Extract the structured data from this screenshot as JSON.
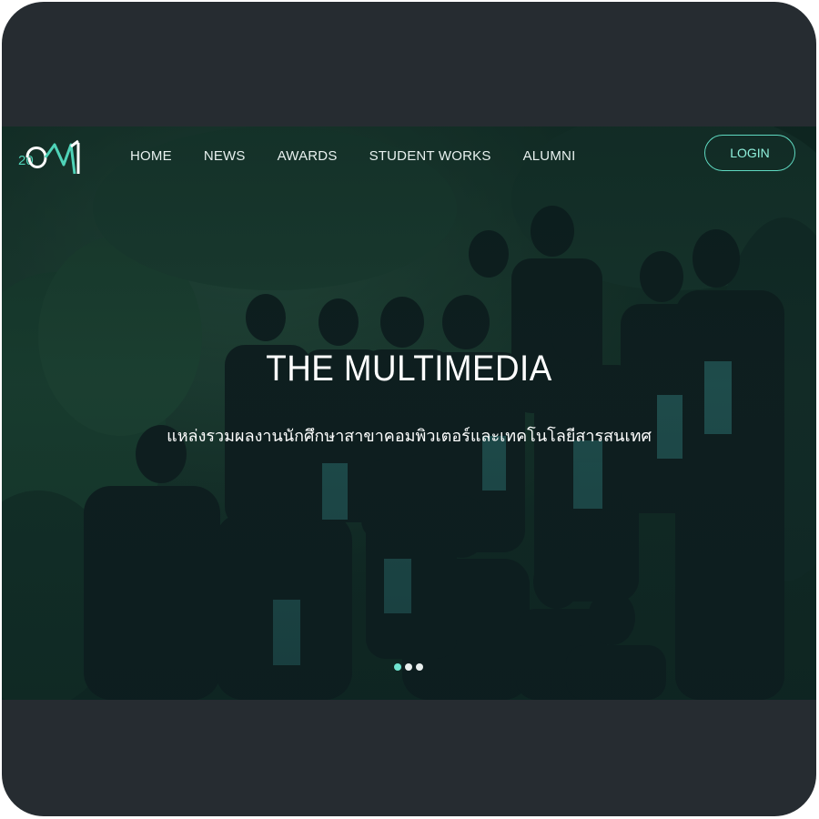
{
  "nav": {
    "logo_text": "20",
    "items": [
      {
        "label": "HOME"
      },
      {
        "label": "NEWS"
      },
      {
        "label": "AWARDS"
      },
      {
        "label": "STUDENT WORKS"
      },
      {
        "label": "ALUMNI"
      }
    ],
    "login_label": "LOGIN"
  },
  "hero": {
    "title": "THE MULTIMEDIA",
    "subtitle": "แหล่งรวมผลงานนักศึกษาสาขาคอมพิวเตอร์และเทคโนโลยีสารสนเทศ",
    "slide_count": 3,
    "active_slide": 1
  },
  "colors": {
    "frame_background": "#262c31",
    "accent": "#5fd9c1",
    "hero_overlay": "#0a1e1e"
  }
}
